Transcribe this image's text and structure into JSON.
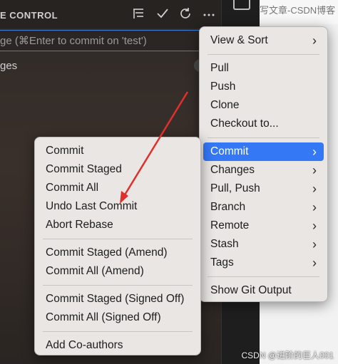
{
  "header": {
    "title": "E CONTROL",
    "icons": [
      "list-tree-icon",
      "check-icon",
      "refresh-icon",
      "more-icon"
    ]
  },
  "commit_input": {
    "placeholder": "ge (⌘Enter to commit on 'test')"
  },
  "changes": {
    "label": "ges"
  },
  "right_panel": {
    "top_text": "写文章-CSDN博客",
    "watermark": "CSDN @进阶的巨人001"
  },
  "main_menu": {
    "groups": [
      [
        {
          "label": "View & Sort",
          "submenu": true
        }
      ],
      [
        {
          "label": "Pull"
        },
        {
          "label": "Push"
        },
        {
          "label": "Clone"
        },
        {
          "label": "Checkout to..."
        }
      ],
      [
        {
          "label": "Commit",
          "submenu": true,
          "active": true
        },
        {
          "label": "Changes",
          "submenu": true
        },
        {
          "label": "Pull, Push",
          "submenu": true
        },
        {
          "label": "Branch",
          "submenu": true
        },
        {
          "label": "Remote",
          "submenu": true
        },
        {
          "label": "Stash",
          "submenu": true
        },
        {
          "label": "Tags",
          "submenu": true
        }
      ],
      [
        {
          "label": "Show Git Output"
        }
      ]
    ]
  },
  "commit_menu": {
    "groups": [
      [
        {
          "label": "Commit"
        },
        {
          "label": "Commit Staged"
        },
        {
          "label": "Commit All"
        },
        {
          "label": "Undo Last Commit"
        },
        {
          "label": "Abort Rebase"
        }
      ],
      [
        {
          "label": "Commit Staged (Amend)"
        },
        {
          "label": "Commit All (Amend)"
        }
      ],
      [
        {
          "label": "Commit Staged (Signed Off)"
        },
        {
          "label": "Commit All (Signed Off)"
        }
      ],
      [
        {
          "label": "Add Co-authors"
        }
      ]
    ]
  },
  "annotation": {
    "arrow_color": "#e0302c"
  },
  "colors": {
    "accent": "#3478f6",
    "menu_bg": "#e9e6e4"
  }
}
